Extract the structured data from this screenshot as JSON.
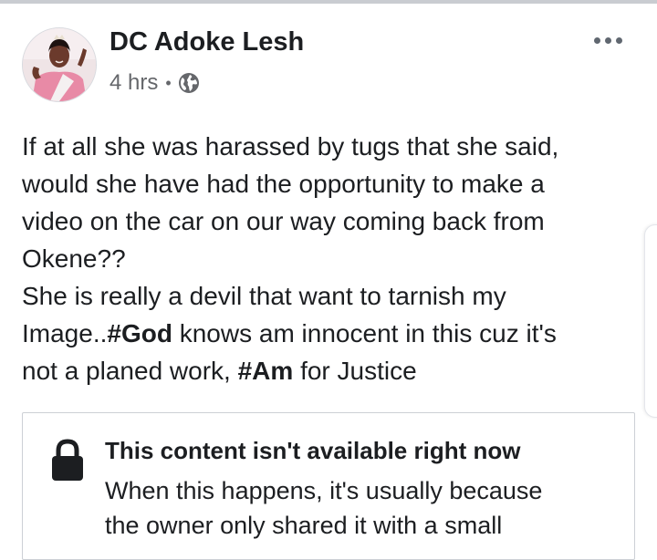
{
  "post": {
    "author": "DC Adoke Lesh",
    "time": "4 hrs",
    "separator": "•",
    "privacy_icon": "globe-icon",
    "more_icon": "more-horizontal-icon",
    "text": {
      "line1": "If at all she was harassed by tugs that she said,",
      "line2": "would she have had the opportunity to make a",
      "line3": "video on the car on our way coming back from",
      "line4": "Okene??",
      "line5": "She is really a devil that want to tarnish my",
      "line6_pre": "Image..",
      "hashtag1": "#God",
      "line6_post": " knows am innocent in this cuz it's",
      "line7_pre": "not a planed work, ",
      "hashtag2": "#Am",
      "line7_post": " for Justice"
    }
  },
  "attachment": {
    "icon": "lock-icon",
    "title": "This content isn't available right now",
    "body_line1": "When this happens, it's usually because",
    "body_line2": "the owner only shared it with a small"
  },
  "colors": {
    "text": "#1c1e21",
    "secondary": "#65676b",
    "border": "#ccd0d5"
  }
}
